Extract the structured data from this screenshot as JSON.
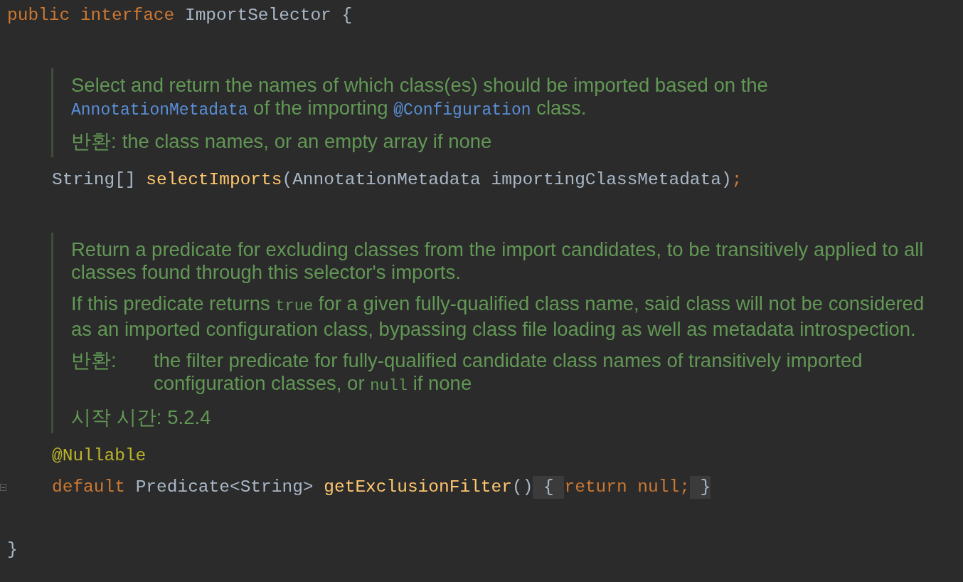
{
  "editor": {
    "items": [
      {
        "kind": "code",
        "foldable": false,
        "tokens": [
          {
            "kind": "keyword",
            "text": "public "
          },
          {
            "kind": "keyword",
            "text": "interface "
          },
          {
            "kind": "plain",
            "text": "ImportSelector {"
          }
        ],
        "children": [
          {
            "kind": "blank"
          },
          {
            "kind": "doc",
            "paragraphs": [
              [
                {
                  "kind": "text",
                  "text": "Select and return the names of which class(es) should be imported based on the "
                },
                {
                  "kind": "link",
                  "text": "AnnotationMetadata"
                },
                {
                  "kind": "text",
                  "text": " of the importing "
                },
                {
                  "kind": "link",
                  "text": "@Configuration"
                },
                {
                  "kind": "text",
                  "text": " class."
                }
              ]
            ],
            "tags": [
              {
                "kind": "inline",
                "label": "반환:",
                "value": [
                  {
                    "kind": "text",
                    "text": "the class names, or an empty array if none"
                  }
                ]
              }
            ]
          },
          {
            "kind": "code",
            "foldable": false,
            "tokens": [
              {
                "kind": "plain",
                "text": "String[] "
              },
              {
                "kind": "method",
                "text": "selectImports"
              },
              {
                "kind": "plain",
                "text": "(AnnotationMetadata importingClassMetadata)"
              },
              {
                "kind": "keyword",
                "text": ";"
              }
            ]
          },
          {
            "kind": "blank"
          },
          {
            "kind": "doc",
            "paragraphs": [
              [
                {
                  "kind": "text",
                  "text": "Return a predicate for excluding classes from the import candidates, to be transitively applied to all classes found through this selector's imports."
                }
              ],
              [
                {
                  "kind": "text",
                  "text": "If this predicate returns "
                },
                {
                  "kind": "code",
                  "text": "true"
                },
                {
                  "kind": "text",
                  "text": " for a given fully-qualified class name, said class will not be considered as an imported configuration class, bypassing class file loading as well as metadata introspection."
                }
              ]
            ],
            "tags": [
              {
                "kind": "column",
                "label": "반환:",
                "value": [
                  {
                    "kind": "text",
                    "text": "the filter predicate for fully-qualified candidate class names of transitively imported configuration classes, or "
                  },
                  {
                    "kind": "code",
                    "text": "null"
                  },
                  {
                    "kind": "text",
                    "text": " if none"
                  }
                ]
              },
              {
                "kind": "inline",
                "label": "시작 시간:",
                "value": [
                  {
                    "kind": "text",
                    "text": "5.2.4"
                  }
                ]
              }
            ]
          },
          {
            "kind": "code",
            "foldable": false,
            "tokens": [
              {
                "kind": "annotation",
                "text": "@Nullable"
              }
            ]
          },
          {
            "kind": "code",
            "foldable": true,
            "tokens": [
              {
                "kind": "keyword",
                "text": "default "
              },
              {
                "kind": "plain",
                "text": "Predicate<String> "
              },
              {
                "kind": "method",
                "text": "getExclusionFilter"
              },
              {
                "kind": "plain",
                "text": "()"
              },
              {
                "kind": "folded",
                "text": " { "
              },
              {
                "kind": "keyword",
                "text": "return null;"
              },
              {
                "kind": "folded",
                "text": " }"
              }
            ]
          },
          {
            "kind": "blank"
          }
        ]
      },
      {
        "kind": "code",
        "foldable": false,
        "tokens": [
          {
            "kind": "plain",
            "text": "}"
          }
        ]
      }
    ]
  }
}
